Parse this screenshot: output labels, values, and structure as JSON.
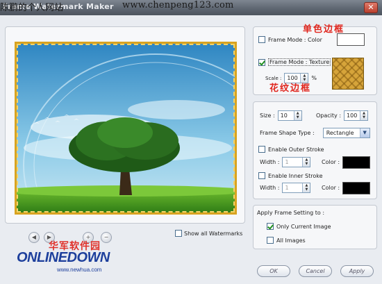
{
  "titlebar": {
    "title": "Frame Watermark Maker",
    "close_glyph": "✕",
    "watermark_left": "陈鹏的个人网站",
    "watermark_right": "www.chenpeng123.com"
  },
  "preview": {
    "show_all_label": "Show all Watermarks",
    "show_all_checked": false
  },
  "frame": {
    "color_mode_label": "Frame Mode : Color",
    "color_mode_checked": false,
    "color_swatch": "#ffffff",
    "texture_mode_label": "Frame Mode : Texture",
    "texture_mode_checked": true,
    "scale_label": "Scale :",
    "scale_value": "100",
    "scale_unit": "%",
    "annotation_color": "单色边框",
    "annotation_texture": "花纹边框"
  },
  "shape": {
    "size_label": "Size :",
    "size_value": "10",
    "opacity_label": "Opacity :",
    "opacity_value": "100",
    "shape_type_label": "Frame Shape Type :",
    "shape_type_value": "Rectangle",
    "outer_stroke_label": "Enable Outer Stroke",
    "outer_stroke_checked": false,
    "outer_width_label": "Width :",
    "outer_width_value": "1",
    "outer_color_label": "Color :",
    "outer_color": "#000000",
    "inner_stroke_label": "Enable Inner Stroke",
    "inner_stroke_checked": false,
    "inner_width_label": "Width :",
    "inner_width_value": "1",
    "inner_color_label": "Color :",
    "inner_color": "#000000"
  },
  "apply": {
    "title": "Apply Frame Setting to :",
    "current_label": "Only Current Image",
    "current_checked": true,
    "all_label": "All Images",
    "all_checked": false
  },
  "buttons": {
    "ok": "OK",
    "cancel": "Cancel",
    "apply": "Apply"
  },
  "logo": {
    "chinese": "华军软件园",
    "main": "ONLINEDOWN",
    "url": "www.newhua.com"
  },
  "colors": {
    "frame_gold": "#d8a320",
    "annotation_red": "#e0261e"
  }
}
